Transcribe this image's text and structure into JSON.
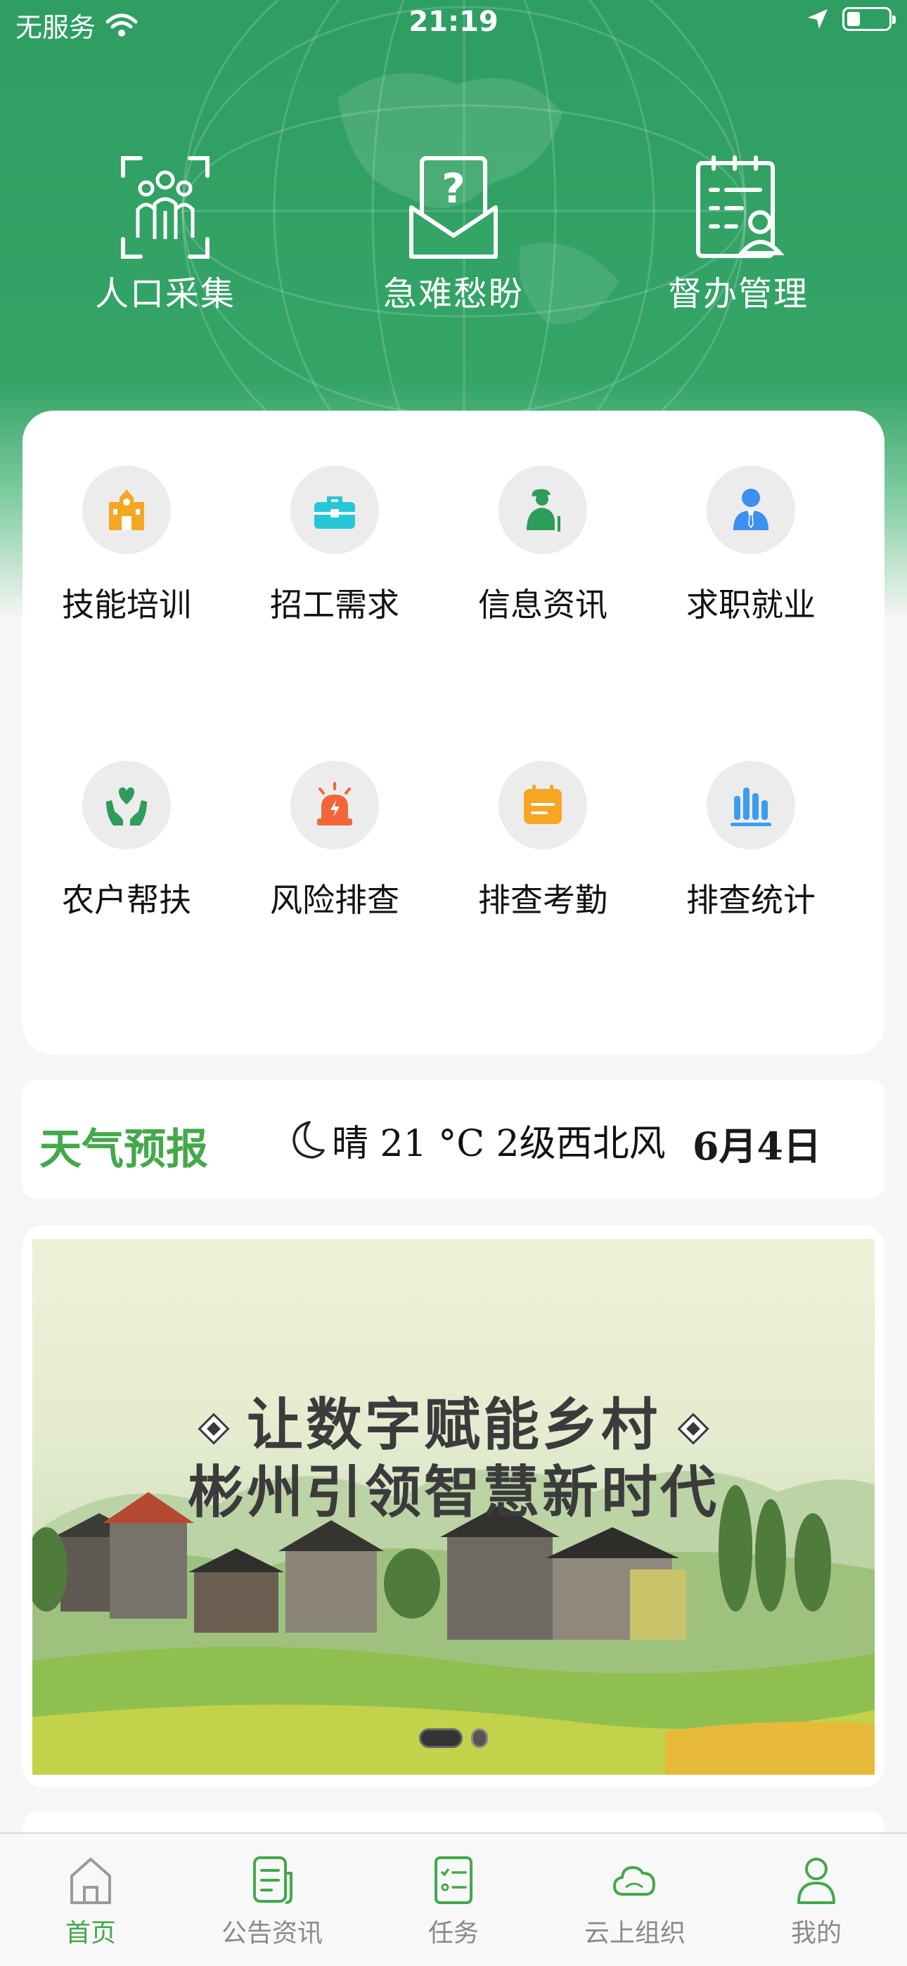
{
  "status_bar": {
    "carrier": "无服务",
    "time": "21:19"
  },
  "top_actions": [
    {
      "label": "人口采集",
      "icon": "people-scan-icon"
    },
    {
      "label": "急难愁盼",
      "icon": "question-envelope-icon"
    },
    {
      "label": "督办管理",
      "icon": "clipboard-person-icon"
    }
  ],
  "grid": [
    {
      "label": "技能培训",
      "icon": "building-icon",
      "color": "#f5a623"
    },
    {
      "label": "招工需求",
      "icon": "toolbox-icon",
      "color": "#27c6d6"
    },
    {
      "label": "信息资讯",
      "icon": "elder-person-icon",
      "color": "#2e9c5a"
    },
    {
      "label": "求职就业",
      "icon": "business-person-icon",
      "color": "#3d8ff0"
    },
    {
      "label": "农户帮扶",
      "icon": "heart-hands-icon",
      "color": "#2e9c5a"
    },
    {
      "label": "风险排查",
      "icon": "alarm-light-icon",
      "color": "#f2653a"
    },
    {
      "label": "排查考勤",
      "icon": "calendar-icon",
      "color": "#f6a623"
    },
    {
      "label": "排查统计",
      "icon": "bar-chart-icon",
      "color": "#3d9cf0"
    }
  ],
  "weather": {
    "title": "天气预报",
    "icon": "moon-icon",
    "condition": "晴 21 °C 2级西北风",
    "date": "6月4日"
  },
  "banner": {
    "line1": "让数字赋能乡村",
    "line2": "彬州引领智慧新时代",
    "page_count": 2,
    "active_page": 1
  },
  "tabbar": [
    {
      "label": "首页",
      "icon": "home-icon",
      "active": true
    },
    {
      "label": "公告资讯",
      "icon": "document-icon",
      "active": false
    },
    {
      "label": "任务",
      "icon": "task-list-icon",
      "active": false
    },
    {
      "label": "云上组织",
      "icon": "cloud-icon",
      "active": false
    },
    {
      "label": "我的",
      "icon": "user-icon",
      "active": false
    }
  ],
  "colors": {
    "brand_green": "#34a467",
    "accent_green": "#43a94a",
    "tab_inactive": "#8a8a8a"
  }
}
